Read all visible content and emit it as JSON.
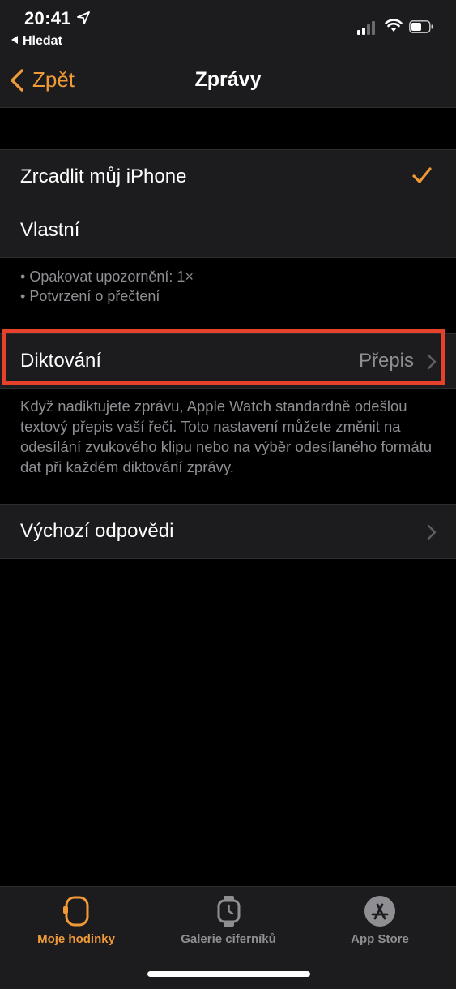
{
  "status_bar": {
    "time": "20:41",
    "back_app": "Hledat"
  },
  "nav": {
    "back_label": "Zpět",
    "title": "Zprávy"
  },
  "options": {
    "mirror_label": "Zrcadlit můj iPhone",
    "custom_label": "Vlastní"
  },
  "notes": [
    "Opakovat upozornění: 1×",
    "Potvrzení o přečtení"
  ],
  "dictation": {
    "label": "Diktování",
    "value": "Přepis",
    "description": "Když nadiktujete zprávu, Apple Watch standardně odešlou textový přepis vaší řeči. Toto nastavení můžete změnit na odesílání zvukového klipu nebo na výběr odesílaného formátu dat při každém diktování zprávy."
  },
  "default_replies": {
    "label": "Výchozí odpovědi"
  },
  "tabs": [
    {
      "label": "Moje hodinky",
      "icon": "watch-icon"
    },
    {
      "label": "Galerie ciferníků",
      "icon": "watch-face-icon"
    },
    {
      "label": "App Store",
      "icon": "app-store-icon"
    }
  ],
  "colors": {
    "accent": "#f09a37",
    "highlight": "#e5412d",
    "background": "#000000",
    "cell": "#1c1c1e"
  }
}
